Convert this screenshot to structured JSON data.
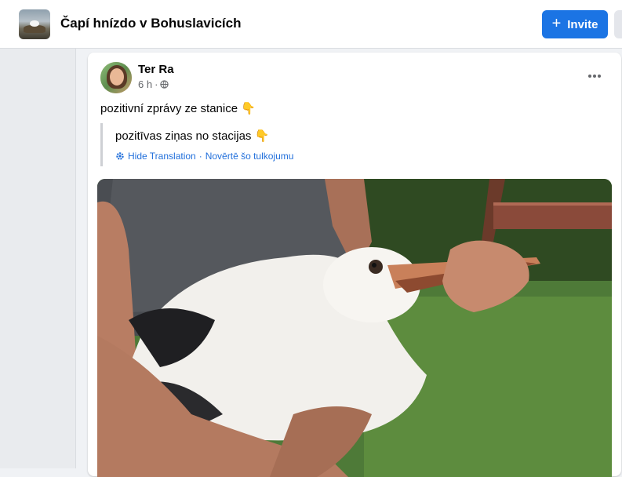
{
  "header": {
    "group_title": "Čapí hnízdo v Bohuslavicích",
    "invite_label": "Invite",
    "invite_icon": "plus-icon"
  },
  "post": {
    "author": "Ter Ra",
    "time": "6 h",
    "separator": "·",
    "audience_icon": "globe-icon",
    "text": "pozitivní zprávy ze stanice 👇",
    "translation": {
      "text": "pozitīvas ziņas no stacijas 👇",
      "hide_label": "Hide Translation",
      "separator": "·",
      "rate_label": "Novērtē šo tulkojumu"
    },
    "photo_alt": "Stork held by a person"
  },
  "colors": {
    "accent": "#1b74e4",
    "link": "#216fdb",
    "background": "#f0f2f5"
  }
}
